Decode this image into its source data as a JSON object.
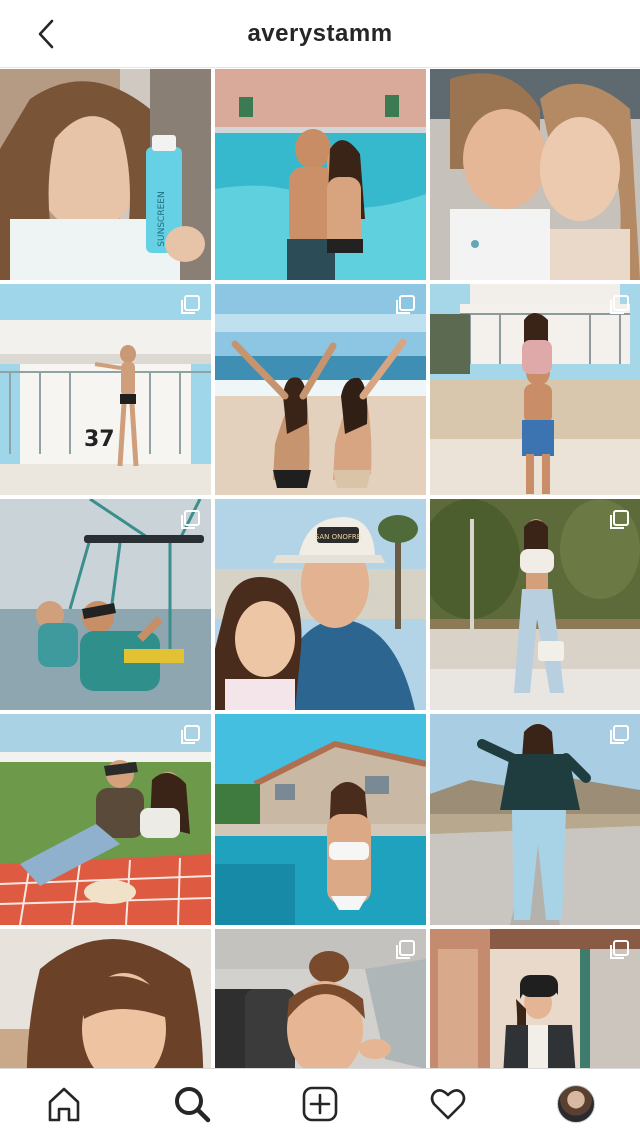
{
  "header": {
    "username": "averystamm",
    "back_icon": "chevron-left-icon"
  },
  "grid": {
    "tiles": [
      {
        "subject": "selfie-holding-sunscreen-bottle",
        "multi": false
      },
      {
        "subject": "couple-by-pool",
        "multi": false
      },
      {
        "subject": "couple-selfie",
        "multi": false
      },
      {
        "subject": "lifeguard-tower-37",
        "multi": true
      },
      {
        "subject": "beach-friends-arms-up",
        "multi": true
      },
      {
        "subject": "couple-lifeguard-tower",
        "multi": true
      },
      {
        "subject": "parasailing",
        "multi": true
      },
      {
        "subject": "couple-selfie-onofre-hat",
        "multi": false
      },
      {
        "subject": "girl-standing-outfit",
        "multi": true
      },
      {
        "subject": "couple-picnic",
        "multi": true
      },
      {
        "subject": "girl-by-pool",
        "multi": false
      },
      {
        "subject": "girl-desert-road",
        "multi": true
      },
      {
        "subject": "selfie-long-hair",
        "multi": false
      },
      {
        "subject": "car-selfie",
        "multi": true
      },
      {
        "subject": "girl-beanie-porch",
        "multi": true
      }
    ],
    "sunscreen_label": "SUNSCREEN",
    "tower_number": "37",
    "hat_text": "SAN ONOFRE"
  },
  "tabbar": {
    "items": [
      "home-icon",
      "search-icon",
      "new-post-icon",
      "activity-heart-icon",
      "profile-avatar"
    ],
    "active": "search-icon"
  },
  "colors": {
    "text": "#262626",
    "sky": "#7fc4dc",
    "pool": "#2fb7c9",
    "sand": "#e9dccb"
  }
}
